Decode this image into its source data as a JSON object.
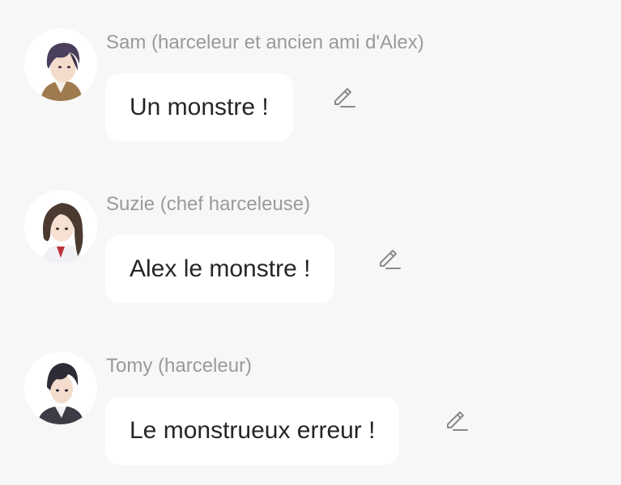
{
  "messages": [
    {
      "speaker": "Sam (harceleur et ancien ami d'Alex)",
      "text": "Un monstre !",
      "avatar_icon": "character-avatar-sam",
      "edit_icon": "pencil-icon",
      "colors": {
        "hair": "#4a3f5c",
        "outfit": "#a07a4f"
      }
    },
    {
      "speaker": "Suzie (chef harceleuse)",
      "text": "Alex le monstre !",
      "avatar_icon": "character-avatar-suzie",
      "edit_icon": "pencil-icon",
      "colors": {
        "hair": "#4b3a30",
        "outfit": "#c0303a"
      }
    },
    {
      "speaker": "Tomy (harceleur)",
      "text": "Le monstrueux erreur !",
      "avatar_icon": "character-avatar-tomy",
      "edit_icon": "pencil-icon",
      "colors": {
        "hair": "#2e2b36",
        "outfit": "#3c3c46"
      }
    }
  ],
  "colors": {
    "background": "#f7f7f7",
    "bubble": "#ffffff",
    "speaker_text": "#9a9a9a",
    "message_text": "#262626",
    "icon": "#8a8a8a"
  }
}
